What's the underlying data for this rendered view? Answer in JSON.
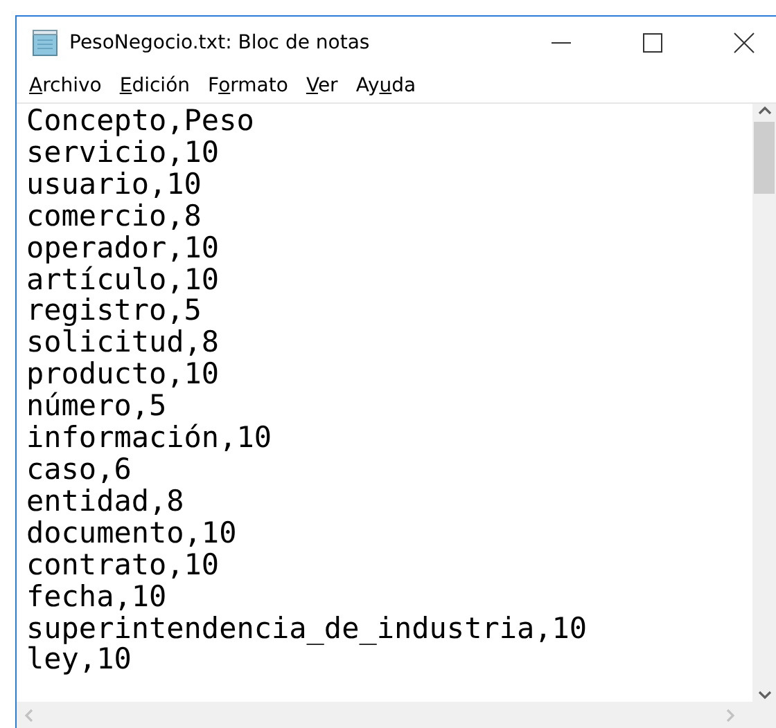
{
  "window": {
    "title": "PesoNegocio.txt: Bloc de notas"
  },
  "menu": [
    {
      "key": "A",
      "after": "rchivo"
    },
    {
      "key": "E",
      "after": "dición"
    },
    {
      "before": "F",
      "key": "o",
      "after": "rmato"
    },
    {
      "key": "V",
      "after": "er"
    },
    {
      "before": "Ay",
      "key": "u",
      "after": "da"
    }
  ],
  "editor": {
    "lines": [
      "Concepto,Peso",
      "servicio,10",
      "usuario,10",
      "comercio,8",
      "operador,10",
      "artículo,10",
      "registro,5",
      "solicitud,8",
      "producto,10",
      "número,5",
      "información,10",
      "caso,6",
      "entidad,8",
      "documento,10",
      "contrato,10",
      "fecha,10",
      "superintendencia_de_industria,10",
      "ley,10"
    ]
  }
}
